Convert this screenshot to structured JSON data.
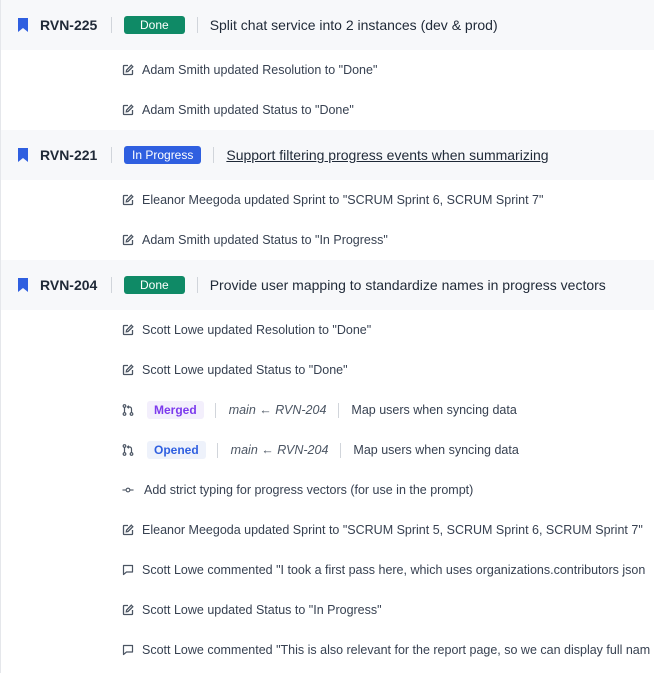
{
  "colors": {
    "issue_icon": "#2f5fe0",
    "done": "#0f8a66",
    "in_progress": "#2f5fe0",
    "merged": "#7c3aed",
    "opened": "#2f5fe0"
  },
  "issues": [
    {
      "icon": "bookmark-icon",
      "key": "RVN-225",
      "status": "Done",
      "title": "Split chat service into 2 instances (dev & prod)",
      "events": [
        {
          "icon": "edit-icon",
          "text": "Adam Smith updated Resolution to \"Done\""
        },
        {
          "icon": "edit-icon",
          "text": "Adam Smith updated Status to \"Done\""
        }
      ]
    },
    {
      "icon": "bookmark-icon",
      "key": "RVN-221",
      "status": "In Progress",
      "title": "Support filtering progress events when summarizing",
      "events": [
        {
          "icon": "edit-icon",
          "text": "Eleanor Meegoda updated Sprint to \"SCRUM Sprint 6, SCRUM Sprint 7\""
        },
        {
          "icon": "edit-icon",
          "text": "Adam Smith updated Status to \"In Progress\""
        }
      ]
    },
    {
      "icon": "bookmark-icon",
      "key": "RVN-204",
      "status": "Done",
      "title": "Provide user mapping to standardize names in progress vectors",
      "events": [
        {
          "icon": "edit-icon",
          "text": "Scott Lowe updated Resolution to \"Done\""
        },
        {
          "icon": "edit-icon",
          "text": "Scott Lowe updated Status to \"Done\""
        },
        {
          "icon": "pull-request-icon",
          "badge": "Merged",
          "branch": "main ← RVN-204",
          "text": "Map users when syncing data"
        },
        {
          "icon": "pull-request-icon",
          "badge": "Opened",
          "branch": "main ← RVN-204",
          "text": "Map users when syncing data"
        },
        {
          "icon": "commit-icon",
          "text": "Add strict typing for progress vectors (for use in the prompt)"
        },
        {
          "icon": "edit-icon",
          "text": "Eleanor Meegoda updated Sprint to \"SCRUM Sprint 5, SCRUM Sprint 6, SCRUM Sprint 7\""
        },
        {
          "icon": "comment-icon",
          "text": "Scott Lowe commented \"I took a first pass here, which uses organizations.contributors json"
        },
        {
          "icon": "edit-icon",
          "text": "Scott Lowe updated Status to \"In Progress\""
        },
        {
          "icon": "comment-icon",
          "text": "Scott Lowe commented \"This is also relevant for the report page, so we can display full nam"
        }
      ]
    }
  ]
}
